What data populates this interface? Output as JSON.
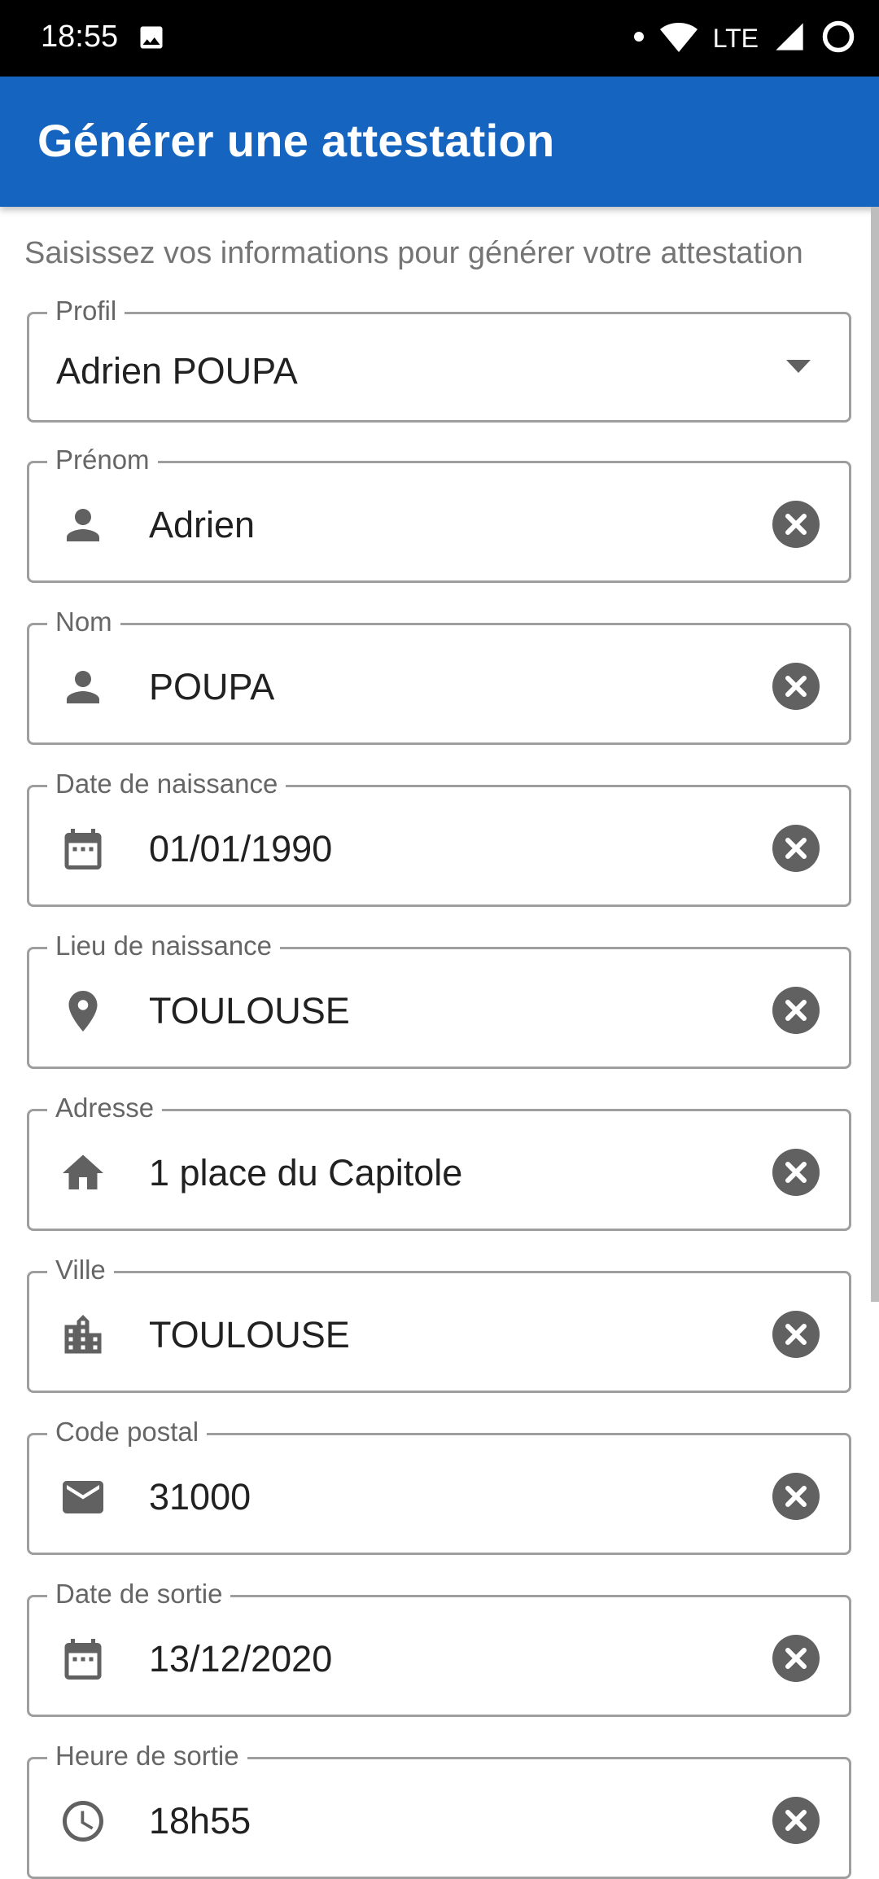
{
  "status_bar": {
    "time": "18:55",
    "network": "LTE",
    "icons": [
      "image-icon",
      "dot-icon",
      "wifi-icon",
      "signal-icon",
      "circle-icon"
    ]
  },
  "app_bar": {
    "title": "Générer une attestation"
  },
  "form": {
    "subtitle": "Saisissez vos informations pour générer votre attestation",
    "profile": {
      "label": "Profil",
      "value": "Adrien POUPA"
    },
    "fields": [
      {
        "label": "Prénom",
        "value": "Adrien",
        "icon": "person-icon"
      },
      {
        "label": "Nom",
        "value": "POUPA",
        "icon": "person-icon"
      },
      {
        "label": "Date de naissance",
        "value": "01/01/1990",
        "icon": "calendar-icon"
      },
      {
        "label": "Lieu de naissance",
        "value": "TOULOUSE",
        "icon": "location-pin-icon"
      },
      {
        "label": "Adresse",
        "value": "1 place du Capitole",
        "icon": "home-icon"
      },
      {
        "label": "Ville",
        "value": "TOULOUSE",
        "icon": "city-icon"
      },
      {
        "label": "Code postal",
        "value": "31000",
        "icon": "mail-icon"
      },
      {
        "label": "Date de sortie",
        "value": "13/12/2020",
        "icon": "calendar-icon"
      },
      {
        "label": "Heure de sortie",
        "value": "18h55",
        "icon": "clock-icon"
      }
    ]
  },
  "colors": {
    "app_bar": "#1565c0",
    "status_bar": "#000000",
    "border": "#9e9e9e",
    "icon": "#616161",
    "label": "#666666",
    "text": "#212121"
  }
}
